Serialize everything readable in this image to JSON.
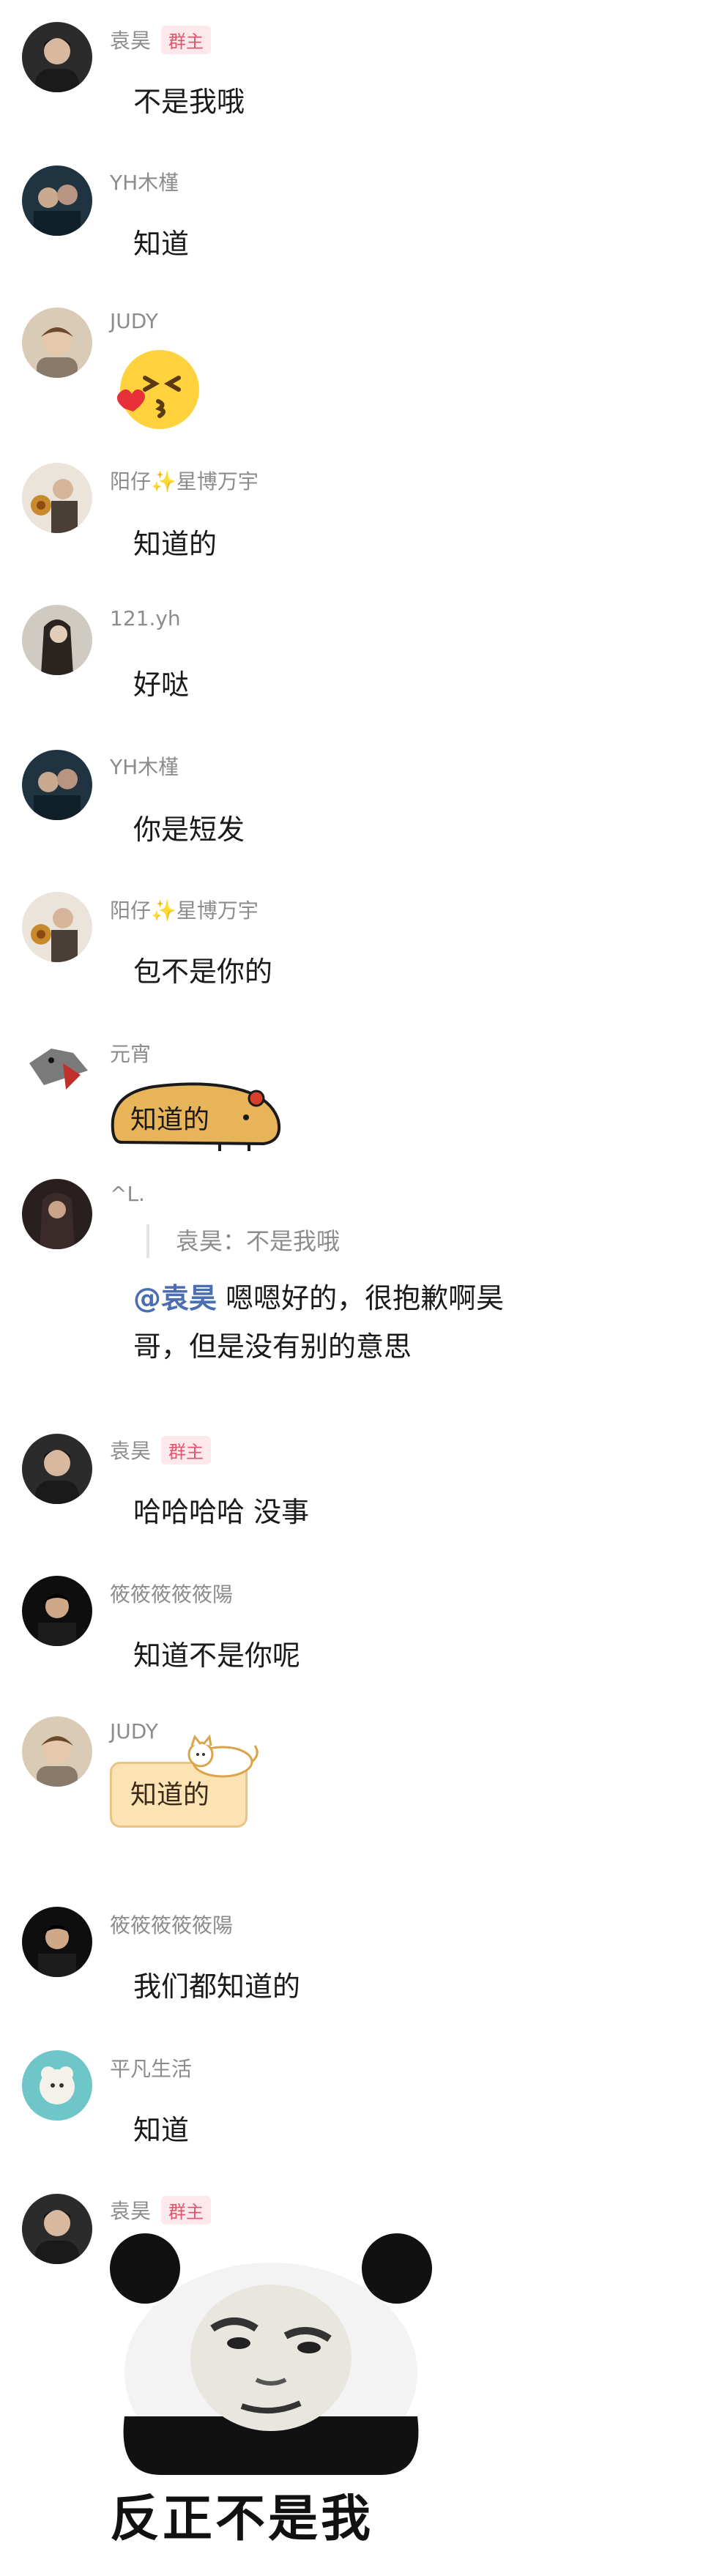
{
  "messages": [
    {
      "nick": "袁昊",
      "badge": "群主",
      "text": "不是我哦",
      "avatar": "man-dark-photo-avatar"
    },
    {
      "nick": "YH木槿",
      "text": "知道",
      "avatar": "couple-photo-avatar"
    },
    {
      "nick": "JUDY",
      "sticker": "kissing-face-emoji",
      "avatar": "young-man-photo-avatar"
    },
    {
      "nick_a": "阳仔",
      "nick_sparkle": "✨",
      "nick_b": "星博万宇",
      "text": "知道的",
      "avatar": "man-with-flower-avatar"
    },
    {
      "nick": "121.yh",
      "text": "好哒",
      "avatar": "girl-photo-avatar"
    },
    {
      "nick": "YH木槿",
      "text": "你是短发",
      "avatar": "couple-photo-avatar"
    },
    {
      "nick_a": "阳仔",
      "nick_sparkle": "✨",
      "nick_b": "星博万宇",
      "text": "包不是你的",
      "avatar": "man-with-flower-avatar"
    },
    {
      "nick": "元宵",
      "sticker_text": "知道的",
      "avatar": "cartoon-bird-avatar"
    },
    {
      "nick": "^L.",
      "quote": "袁昊：不是我哦",
      "mention": "@袁昊",
      "reply_line1": " 嗯嗯好的，很抱歉啊昊",
      "reply_line2": "哥，但是没有别的意思",
      "avatar": "dark-girl-photo-avatar"
    },
    {
      "nick": "袁昊",
      "badge": "群主",
      "text": "哈哈哈哈 没事",
      "avatar": "man-dark-photo-avatar"
    },
    {
      "nick": "筱筱筱筱筱陽",
      "text": "知道不是你呢",
      "avatar": "man-black-photo-avatar"
    },
    {
      "nick": "JUDY",
      "sticker_text": "知道的",
      "avatar": "young-man-photo-avatar"
    },
    {
      "nick": "筱筱筱筱筱陽",
      "text": "我们都知道的",
      "avatar": "man-black-photo-avatar"
    },
    {
      "nick": "平凡生活",
      "text": "知道",
      "avatar": "toy-photo-avatar"
    },
    {
      "nick": "袁昊",
      "badge": "群主",
      "meme_caption": "反正不是我",
      "avatar": "man-dark-photo-avatar"
    }
  ],
  "colors": {
    "nick": "#8c8c8c",
    "badge_text": "#e0566e",
    "badge_bg": "#fde8ec",
    "mention": "#4b6eb0",
    "text": "#1a1a1a"
  }
}
